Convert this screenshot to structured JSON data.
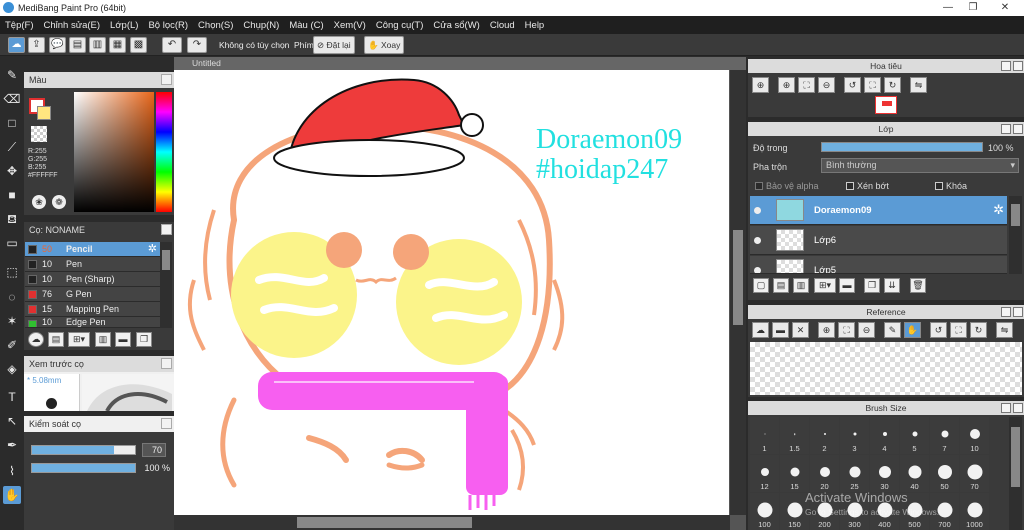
{
  "title": "MediBang Paint Pro (64bit)",
  "window_controls": {
    "minimize": "—",
    "restore": "❐",
    "close": "✕"
  },
  "menu": [
    "Tệp(F)",
    "Chỉnh sửa(E)",
    "Lớp(L)",
    "Bộ lọc(R)",
    "Chọn(S)",
    "Chụp(N)",
    "Màu (C)",
    "Xem(V)",
    "Công cụ(T)",
    "Cửa sổ(W)",
    "Cloud",
    "Help"
  ],
  "toolbar": {
    "no_options": "Không có tùy chọn",
    "shortcut_label": "Phím",
    "reset_label": "Đặt lại",
    "rotate_label": "Xoay"
  },
  "color_panel": {
    "title": "Màu",
    "r": "R:255",
    "g": "G:255",
    "b": "B:255",
    "hex": "#FFFFFF"
  },
  "brush_panel": {
    "title": "Cọ: NONAME",
    "items": [
      {
        "size": "50",
        "name": "Pencil",
        "color": "#222222"
      },
      {
        "size": "10",
        "name": "Pen",
        "color": "#222222"
      },
      {
        "size": "10",
        "name": "Pen (Sharp)",
        "color": "#222222"
      },
      {
        "size": "76",
        "name": "G Pen",
        "color": "#e03030"
      },
      {
        "size": "15",
        "name": "Mapping Pen",
        "color": "#e03030"
      },
      {
        "size": "10",
        "name": "Edge Pen",
        "color": "#30c030"
      }
    ]
  },
  "preview_panel": {
    "title": "Xem trước cọ",
    "size": "5.08mm"
  },
  "control_panel": {
    "title": "Kiểm soát cọ",
    "size_value": "70",
    "opacity_value": "100 %",
    "size_fill": 0.8,
    "opacity_fill": 1.0
  },
  "canvas": {
    "tab": "Untitled",
    "text1": "Doraemon09",
    "text2": "#hoidap247",
    "text_color": "#22e0e0"
  },
  "navigator": {
    "title": "Hoa tiêu"
  },
  "layers": {
    "title": "Lớp",
    "opacity_label": "Độ trong",
    "opacity_value": "100 %",
    "opacity_fill": 1.0,
    "blend_label": "Pha trộn",
    "blend_value": "Bình thường",
    "protect_alpha": "Bảo vệ alpha",
    "clipping": "Xén bớt",
    "lock": "Khóa",
    "items": [
      {
        "name": "Doraemon09",
        "selected": true
      },
      {
        "name": "Lớp6",
        "selected": false
      },
      {
        "name": "Lớp5",
        "selected": false
      }
    ]
  },
  "reference": {
    "title": "Reference"
  },
  "brush_size": {
    "title": "Brush Size",
    "sizes": [
      "1",
      "1.5",
      "2",
      "3",
      "4",
      "5",
      "7",
      "10",
      "12",
      "15",
      "20",
      "25",
      "30",
      "40",
      "50",
      "70",
      "100",
      "150",
      "200",
      "300",
      "400",
      "500",
      "700",
      "1000"
    ]
  },
  "watermark": {
    "line1": "Activate Windows",
    "line2": "Go to Settings to activate Windows."
  }
}
